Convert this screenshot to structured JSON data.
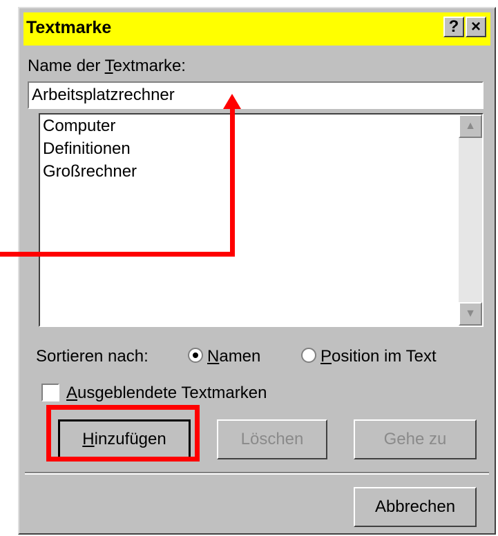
{
  "dialog": {
    "title": "Textmarke",
    "help_button": "?",
    "close_button": "×"
  },
  "name_label": {
    "prefix": "Name der ",
    "accel": "T",
    "suffix": "extmarke:"
  },
  "name_value": "Arbeitsplatzrechner",
  "list": {
    "items": [
      "Computer",
      "Definitionen",
      "Großrechner"
    ]
  },
  "sort": {
    "label": "Sortieren nach:",
    "names": {
      "accel": "N",
      "rest": "amen",
      "selected": true
    },
    "position": {
      "accel": "P",
      "rest": "osition im Text",
      "selected": false
    }
  },
  "hidden": {
    "accel": "A",
    "rest": "usgeblendete Textmarken",
    "checked": false
  },
  "buttons": {
    "add": {
      "accel": "H",
      "rest": "inzufügen"
    },
    "delete": "Löschen",
    "goto": "Gehe zu",
    "cancel": "Abbrechen"
  },
  "colors": {
    "title_bg": "#ffff00",
    "annotation": "#ff0000",
    "dialog_bg": "#c0c0c0"
  }
}
